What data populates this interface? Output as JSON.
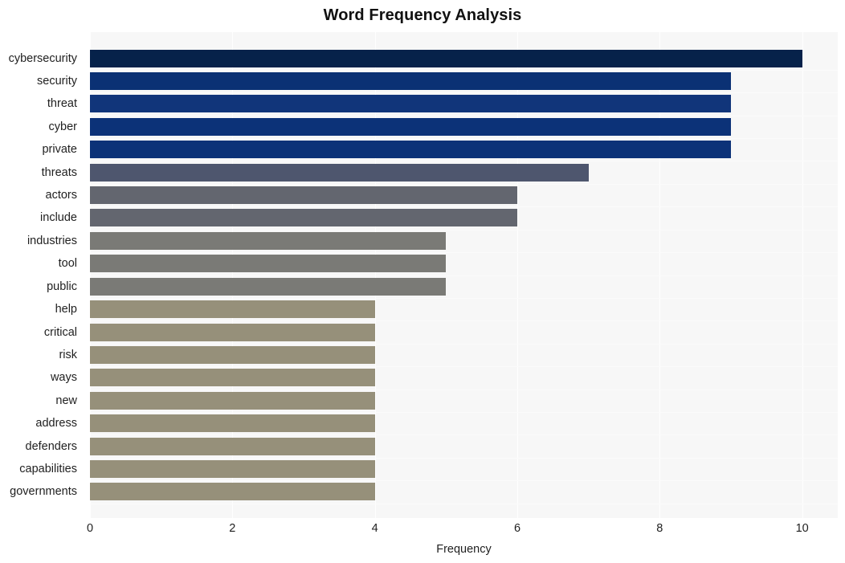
{
  "chart_data": {
    "type": "bar",
    "orientation": "horizontal",
    "title": "Word Frequency Analysis",
    "xlabel": "Frequency",
    "ylabel": "",
    "xlim": [
      0,
      10.5
    ],
    "xticks": [
      0,
      2,
      4,
      6,
      8,
      10
    ],
    "xtick_labels": [
      "0",
      "2",
      "4",
      "6",
      "8",
      "10"
    ],
    "grid": true,
    "grid_axis": "x",
    "legend": null,
    "plot_background": "#f7f7f7",
    "figure_background": "#ffffff",
    "categories": [
      "cybersecurity",
      "security",
      "threat",
      "cyber",
      "private",
      "threats",
      "actors",
      "include",
      "industries",
      "tool",
      "public",
      "help",
      "critical",
      "risk",
      "ways",
      "new",
      "address",
      "defenders",
      "capabilities",
      "governments"
    ],
    "values": [
      10,
      9,
      9,
      9,
      9,
      7,
      6,
      6,
      5,
      5,
      5,
      4,
      4,
      4,
      4,
      4,
      4,
      4,
      4,
      4
    ],
    "bar_colors": [
      "#06224a",
      "#0b3174",
      "#11357a",
      "#0c3278",
      "#0c3278",
      "#4e566e",
      "#63666f",
      "#63666f",
      "#7a7a76",
      "#7a7a76",
      "#7a7a76",
      "#96907a",
      "#96907a",
      "#96907a",
      "#96907a",
      "#96907a",
      "#96907a",
      "#96907a",
      "#96907a",
      "#96907a"
    ]
  }
}
